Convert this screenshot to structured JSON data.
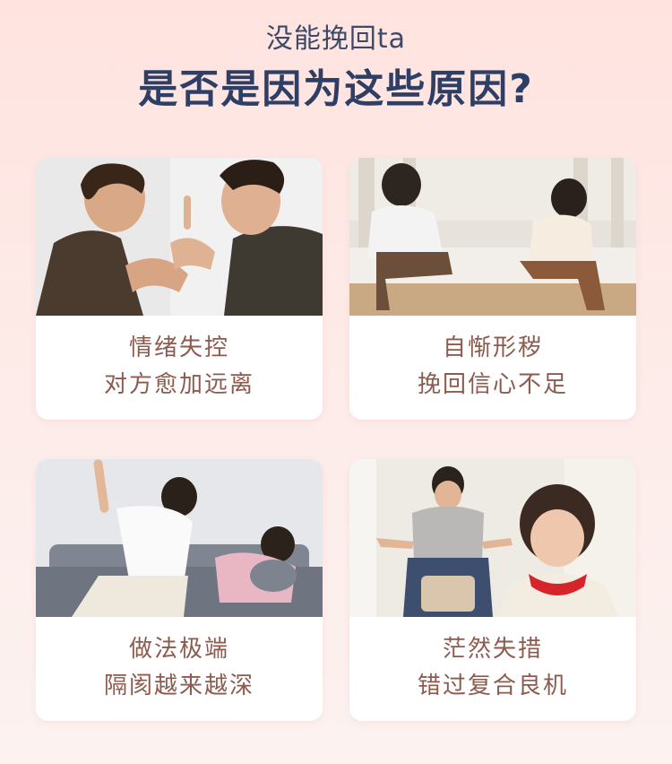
{
  "header": {
    "subtitle": "没能挽回ta",
    "headline": "是否是因为这些原因?"
  },
  "cards": [
    {
      "line1": "情绪失控",
      "line2": "对方愈加远离",
      "photo": "couple-arguing-photo"
    },
    {
      "line1": "自惭形秽",
      "line2": "挽回信心不足",
      "photo": "couple-sad-on-couch-photo"
    },
    {
      "line1": "做法极端",
      "line2": "隔阂越来越深",
      "photo": "couple-conflict-on-sofa-photo"
    },
    {
      "line1": "茫然失措",
      "line2": "错过复合良机",
      "photo": "couple-confused-photo"
    }
  ],
  "colors": {
    "headline": "#2e3f66",
    "card_text": "#8d5a4e",
    "background": "#fde6e2"
  }
}
